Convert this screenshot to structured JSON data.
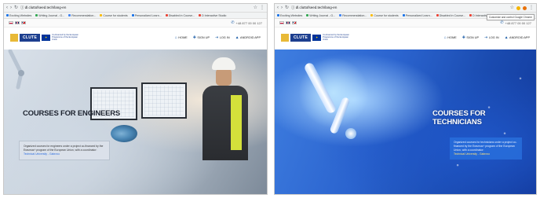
{
  "browser": {
    "url": "ⓘ dl.cluttofseed.tech/lang-en",
    "left_bookmarks": [
      "Exciting Websites",
      "Writing Journal - G...",
      "Recommendation...",
      "Course for students",
      "Personalized Learn...",
      "Disabled in Course...",
      "D Interactive Studio",
      "Open Learning Ressources",
      "Flex Cloud Collection"
    ],
    "right_bookmarks": [
      "Exciting Websites",
      "Writing Journal - G...",
      "Recommendation...",
      "Course for students",
      "Personalized Learn...",
      "Disabled in Course...",
      "D Interactive Studio",
      "Open Learning Ressources",
      "Flex Cloud Collection"
    ],
    "tooltip": "Customize and control Google Chrome"
  },
  "site": {
    "contact": "+48 877 00 00 127",
    "logo_text": "CLUTE",
    "logo_sub": "Co-financed by the European Programme of the European Union",
    "menu": [
      {
        "label": "HOME",
        "icon": "home-icon"
      },
      {
        "label": "SIGN UP",
        "icon": "user-plus-icon"
      },
      {
        "label": "LOG IN",
        "icon": "login-icon"
      },
      {
        "label": "ANDROID APP",
        "icon": "android-icon"
      }
    ]
  },
  "panels": {
    "engineers": {
      "title": "COURSES FOR ENGINEERS",
      "description": "Organized courses for engineers under a project co-financed by the Erasmus+ program of the European Union, with a coordinator:",
      "link": "Technical University - Gabrovo"
    },
    "technicians": {
      "title": "COURSES FOR TECHNICIANS",
      "description": "Organized courses for technicians under a project co-financed by the Erasmus+ program of the European Union, with a coordinator:",
      "link": "Technical University - Gabrovo"
    }
  },
  "colors": {
    "brand_blue": "#1d3f8f",
    "accent_yellow": "#e8b937",
    "tech_blue": "#2b64cf"
  }
}
